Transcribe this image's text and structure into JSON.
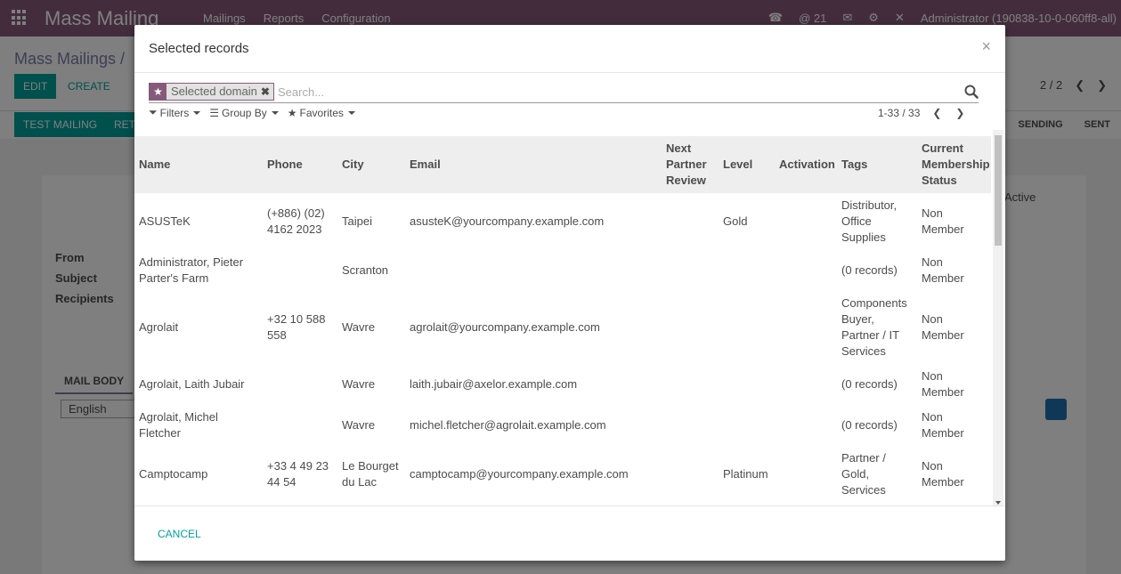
{
  "bg": {
    "app_title": "Mass Mailing",
    "menu": [
      "Mailings",
      "Reports",
      "Configuration"
    ],
    "topright": {
      "messages_count": "@ 21",
      "user": "Administrator (190838-10-0-060ff8-all)"
    },
    "breadcrumb": "Mass Mailings /",
    "edit_label": "EDIT",
    "create_label": "CREATE",
    "pager": "2 / 2",
    "test_mailing_label": "TEST MAILING",
    "retry_label": "RET",
    "stages": [
      "SENDING",
      "SENT"
    ],
    "form_labels": {
      "from": "From",
      "subject": "Subject",
      "recipients": "Recipients"
    },
    "mail_body_tab": "MAIL BODY",
    "language": "English",
    "active_text": "Active"
  },
  "modal": {
    "title": "Selected records",
    "close_glyph": "×",
    "facet_label": "Selected domain",
    "search_placeholder": "Search...",
    "filters_label": "Filters",
    "groupby_label": "Group By",
    "favorites_label": "Favorites",
    "pager_value": "1-33 / 33",
    "cancel_label": "CANCEL"
  },
  "table": {
    "columns": [
      "Name",
      "Phone",
      "City",
      "Email",
      "Next Partner Review",
      "Level",
      "Activation",
      "Tags",
      "Current Membership Status"
    ],
    "rows": [
      {
        "name": "ASUSTeK",
        "phone": "(+886) (02) 4162 2023",
        "city": "Taipei",
        "email": "asusteK@yourcompany.example.com",
        "review": "",
        "level": "Gold",
        "activation": "",
        "tags": "Distributor, Office Supplies",
        "status": "Non Member"
      },
      {
        "name": "Administrator, Pieter Parter's Farm",
        "phone": "",
        "city": "Scranton",
        "email": "",
        "review": "",
        "level": "",
        "activation": "",
        "tags": "(0 records)",
        "status": "Non Member"
      },
      {
        "name": "Agrolait",
        "phone": "+32 10 588 558",
        "city": "Wavre",
        "email": "agrolait@yourcompany.example.com",
        "review": "",
        "level": "",
        "activation": "",
        "tags": "Components Buyer, Partner / IT Services",
        "status": "Non Member"
      },
      {
        "name": "Agrolait, Laith Jubair",
        "phone": "",
        "city": "Wavre",
        "email": "laith.jubair@axelor.example.com",
        "review": "",
        "level": "",
        "activation": "",
        "tags": "(0 records)",
        "status": "Non Member"
      },
      {
        "name": "Agrolait, Michel Fletcher",
        "phone": "",
        "city": "Wavre",
        "email": "michel.fletcher@agrolait.example.com",
        "review": "",
        "level": "",
        "activation": "",
        "tags": "(0 records)",
        "status": "Non Member"
      },
      {
        "name": "Camptocamp",
        "phone": "+33 4 49 23 44 54",
        "city": "Le Bourget du Lac",
        "email": "camptocamp@yourcompany.example.com",
        "review": "",
        "level": "Platinum",
        "activation": "",
        "tags": "Partner / Gold, Services",
        "status": "Non Member"
      }
    ]
  },
  "colors": {
    "brand": "#875a7b",
    "accent": "#00a09d"
  }
}
